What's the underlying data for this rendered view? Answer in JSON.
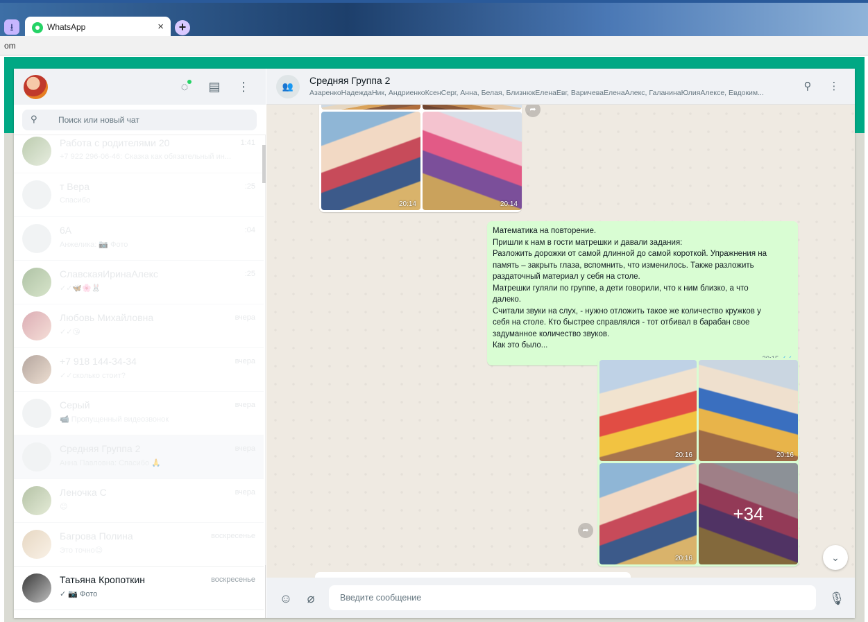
{
  "browser": {
    "tab_title": "WhatsApp",
    "tab_close": "×",
    "new_tab": "+",
    "address_text": "om"
  },
  "colors": {
    "brand": "#00a884",
    "outgoing_bubble": "#d9fdd3",
    "panel_header": "#f0f2f5",
    "read_ticks": "#53bdeb"
  },
  "sidebar": {
    "icons": [
      "status-icon",
      "new-chat-icon",
      "menu-icon"
    ],
    "search": {
      "placeholder": "Поиск или новый чат"
    },
    "chats": [
      {
        "name": "Работа с родителями 20",
        "time": "1:41",
        "preview": "+7 922 296-06-46: Сказка как обязательный ин..."
      },
      {
        "name": "т Вера",
        "time": ":25",
        "preview": "Спасибо"
      },
      {
        "name": "6А",
        "time": ":04",
        "preview": "Анжелика: 📷 Фото"
      },
      {
        "name": "СлавскаяИринаАлекс",
        "time": ":25",
        "preview": "✓✓🦋🌸🐰"
      },
      {
        "name": "Любовь Михайловна",
        "time": "вчера",
        "preview": "✓✓😘"
      },
      {
        "name": "+7 918 144-34-34",
        "time": "вчера",
        "preview": "✓✓сколько стоит?"
      },
      {
        "name": "Серый",
        "time": "вчера",
        "preview": "📹 Пропущенный видеозвонок"
      },
      {
        "name": "Средняя Группа 2",
        "time": "вчера",
        "preview": "Анна Павловна: Спасибо 🙏"
      },
      {
        "name": "Леночка С",
        "time": "вчера",
        "preview": "😊"
      },
      {
        "name": "Багрова Полина",
        "time": "воскресенье",
        "preview": "Это точно😉"
      },
      {
        "name": "Татьяна Кропоткин",
        "time": "воскресенье",
        "preview": "✓ 📷 Фото"
      }
    ]
  },
  "chat": {
    "title": "Средняя Группа 2",
    "members": "АзаренкоНадеждаНик, АндриенкоКсенСерг, Анна, Белая, БлизнюкЕленаЕвг, ВаричеваЕленаАлекс, ГаланинаЮлияАлексе, Евдоким...",
    "icons": [
      "search-icon",
      "menu-icon"
    ],
    "incoming_photos": [
      {
        "time": "20:14"
      },
      {
        "time": "20:14"
      }
    ],
    "text_message": {
      "lines": [
        "Математика на повторение.",
        "Пришли к нам в гости матрешки и давали задания:",
        "Разложить дорожки от самой длинной до самой короткой. Упражнения на",
        "память – закрыть глаза, вспомнить, что изменилось. Также разложить",
        "раздаточный материал у себя на столе.",
        "Матрешки гуляли по группе, а дети говорили, что к ним близко, а что",
        "далеко.",
        "Считали звуки на слух, - нужно отложить такое же количество кружков у",
        "себя на столе. Кто быстрее справлялся - тот отбивал в барабан свое",
        "задуманное количество звуков.",
        "Как это было..."
      ],
      "time": "20:15",
      "ticks": "✓✓"
    },
    "outgoing_photos": [
      {
        "time": "20:16"
      },
      {
        "time": "20:16"
      },
      {
        "time": "20:16"
      },
      {
        "more": "+34"
      }
    ]
  },
  "composer": {
    "placeholder": "Введите сообщение"
  }
}
